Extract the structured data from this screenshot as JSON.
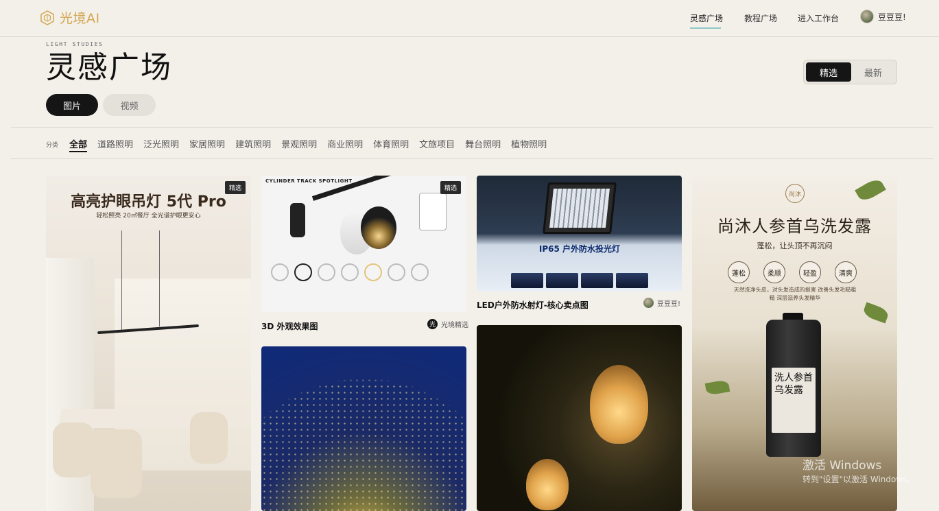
{
  "header": {
    "logo_text": "光境AI",
    "nav": [
      "灵感广场",
      "教程广场",
      "进入工作台"
    ],
    "user_name": "豆豆豆!",
    "accent_color": "#d4a650"
  },
  "page": {
    "eyebrow": "LIGHT STUDIES",
    "title": "灵感广场",
    "media_tabs": [
      "图片",
      "视频"
    ],
    "sort_tabs": [
      "精选",
      "最新"
    ]
  },
  "categories": {
    "label": "分类",
    "items": [
      "全部",
      "道路照明",
      "泛光照明",
      "家居照明",
      "建筑照明",
      "景观照明",
      "商业照明",
      "体育照明",
      "文旅项目",
      "舞台照明",
      "植物照明"
    ]
  },
  "cards": {
    "c1": {
      "badge": "精选",
      "title": "高亮护眼吊灯 5代 Pro",
      "subtitle": "轻松照亮 20㎡餐厅 全光谱护眼更安心"
    },
    "c2": {
      "badge": "精选",
      "heading": "CYLINDER TRACK SPOTLIGHT",
      "caption": "3D 外观效果图",
      "author_icon": "光",
      "author": "光境精选"
    },
    "c3": {
      "band": "IP65 户外防水投光灯",
      "caption": "LED户外防水射灯-核心卖点图",
      "author": "豆豆豆!"
    },
    "c6": {
      "logo": "尚沐",
      "title": "尚沐人参首乌洗发露",
      "slogan": "蓬松，让头顶不再沉闷",
      "tags": [
        "蓬松",
        "柔顺",
        "轻盈",
        "清爽"
      ],
      "small_text": "天然洗净头皮，对头发造成的损害 改善头发毛糙粗糙 深层滋养头发精华",
      "bottle_label": "洗人参首乌发露"
    }
  },
  "watermark": {
    "line1": "激活 Windows",
    "line2": "转到\"设置\"以激活 Windows。"
  }
}
